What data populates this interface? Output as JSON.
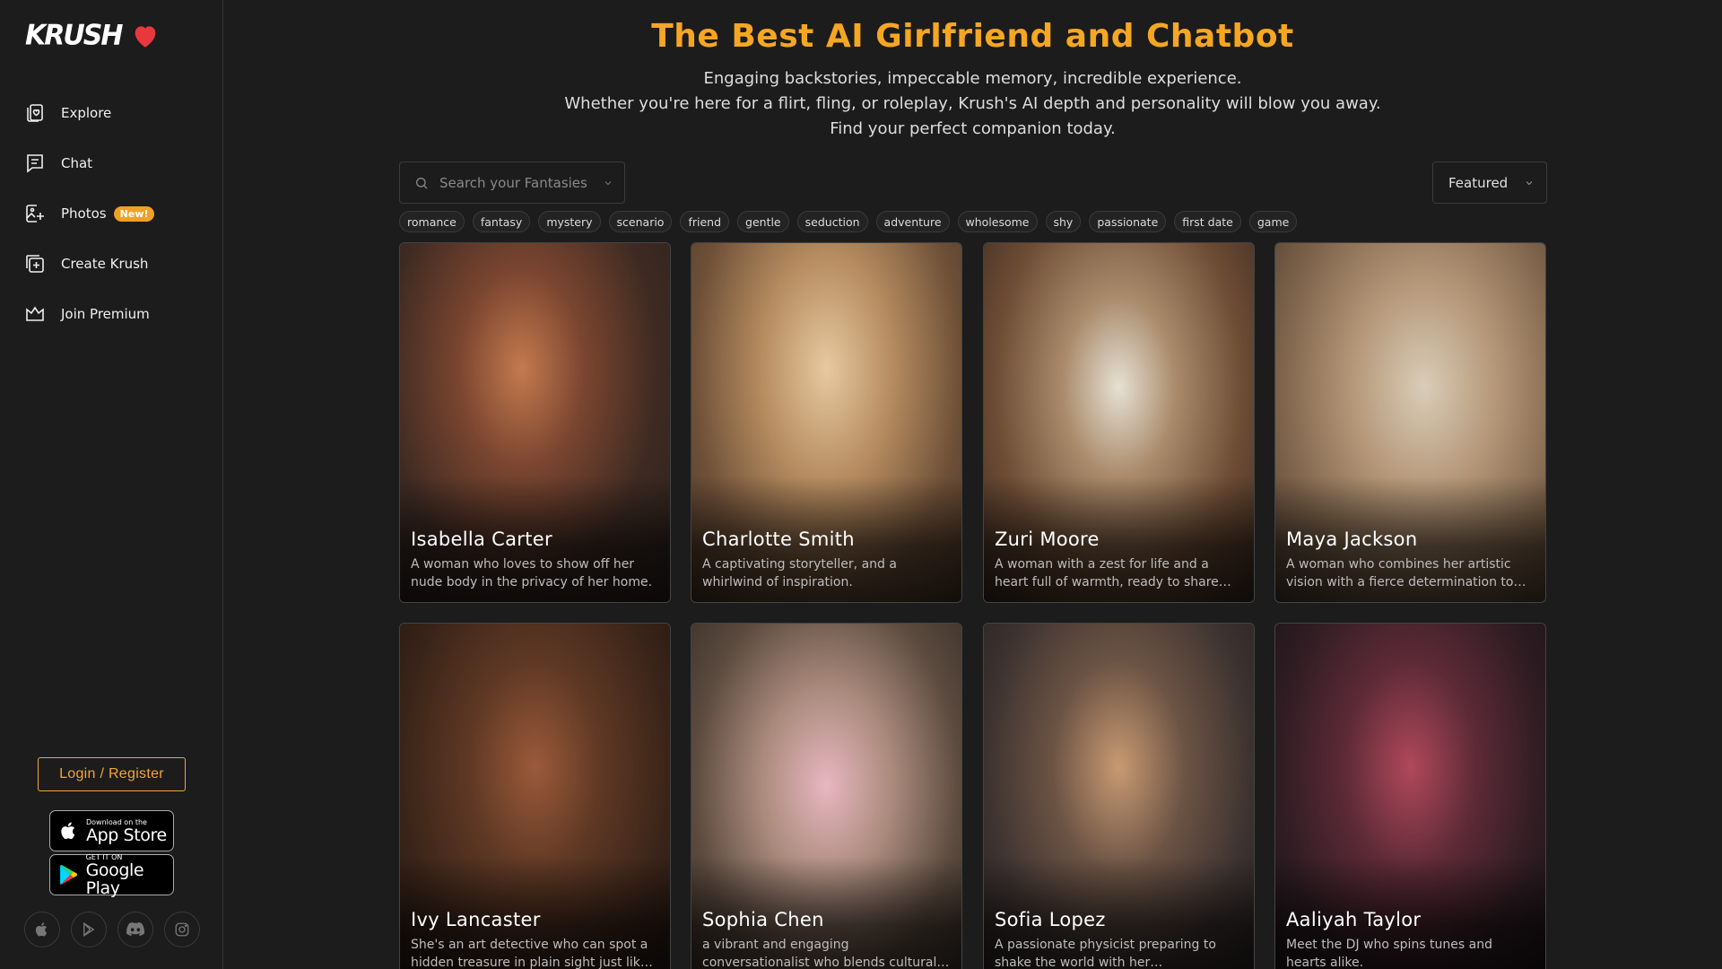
{
  "brand": {
    "name": "KRUSH",
    "accent": "#f5a623",
    "heart_color": "#e8383d"
  },
  "sidebar": {
    "items": [
      {
        "label": "Explore",
        "icon": "explore-heart-icon"
      },
      {
        "label": "Chat",
        "icon": "chat-icon"
      },
      {
        "label": "Photos",
        "icon": "photos-icon",
        "badge": "New!"
      },
      {
        "label": "Create Krush",
        "icon": "create-plus-icon"
      },
      {
        "label": "Join Premium",
        "icon": "crown-icon"
      }
    ],
    "login_label": "Login / Register",
    "app_store": {
      "small": "Download on the",
      "big": "App Store"
    },
    "google_play": {
      "small": "GET IT ON",
      "big": "Google Play"
    },
    "socials": [
      "apple-icon",
      "play-icon",
      "discord-icon",
      "instagram-icon"
    ]
  },
  "hero": {
    "title": "The Best AI Girlfriend and Chatbot",
    "line1": "Engaging backstories, impeccable memory, incredible experience.",
    "line2": "Whether you're here for a flirt, fling, or roleplay, Krush's AI depth and personality will blow you away.",
    "line3": "Find your perfect companion today."
  },
  "search": {
    "placeholder": "Search your Fantasies"
  },
  "sort": {
    "selected": "Featured"
  },
  "tags": [
    "romance",
    "fantasy",
    "mystery",
    "scenario",
    "friend",
    "gentle",
    "seduction",
    "adventure",
    "wholesome",
    "shy",
    "passionate",
    "first date",
    "game"
  ],
  "cards": [
    {
      "name": "Isabella Carter",
      "desc": "A woman who loves to show off her nude body in the privacy of her home."
    },
    {
      "name": "Charlotte Smith",
      "desc": "A captivating storyteller, and a whirlwind of inspiration."
    },
    {
      "name": "Zuri Moore",
      "desc": "A woman with a zest for life and a heart full of warmth, ready to share…"
    },
    {
      "name": "Maya Jackson",
      "desc": "A woman who combines her artistic vision with a fierce determination to…"
    },
    {
      "name": "Ivy Lancaster",
      "desc": "She's an art detective who can spot a hidden treasure in plain sight just lik…"
    },
    {
      "name": "Sophia Chen",
      "desc": "a vibrant and engaging conversationalist who blends cultural…"
    },
    {
      "name": "Sofia Lopez",
      "desc": "A passionate physicist preparing to shake the world with her…"
    },
    {
      "name": "Aaliyah Taylor",
      "desc": "Meet the DJ who spins tunes and hearts alike."
    }
  ]
}
